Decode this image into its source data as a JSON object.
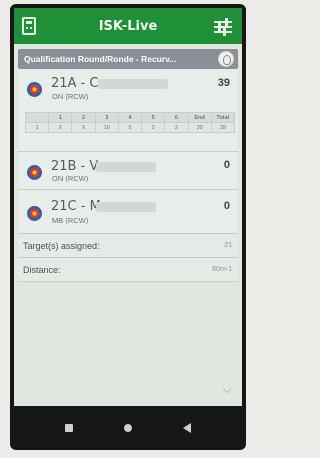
{
  "app": {
    "title": "ISK-Live"
  },
  "round": {
    "label": "Qualification Round/Ronde - Recurv..."
  },
  "archers": [
    {
      "code": "21A - C",
      "division": "ON (RCW)",
      "score": "39",
      "table": {
        "headers": [
          "",
          "1",
          "2",
          "3",
          "4",
          "5",
          "6",
          "End",
          "Total"
        ],
        "rows": [
          [
            "1",
            "X",
            "X",
            "10",
            "5",
            "2",
            "2",
            "39",
            "39"
          ]
        ]
      }
    },
    {
      "code": "21B - V",
      "division": "ON (RCW)",
      "score": "0"
    },
    {
      "code": "21C - M",
      "division": "MB (RCW)",
      "score": "0"
    }
  ],
  "info": {
    "targets_label": "Target(s) assigned:",
    "targets_value": "21",
    "distance_label": "Distance:",
    "distance_value": "60m-1"
  },
  "colors": {
    "appbar": "#1f8f38",
    "round_bar": "#8c8f98"
  },
  "icons": [
    "scoresheet-icon",
    "settings-sliders-icon",
    "round-info-icon",
    "target-icon",
    "nav-recent-icon",
    "nav-home-icon",
    "nav-back-icon"
  ]
}
